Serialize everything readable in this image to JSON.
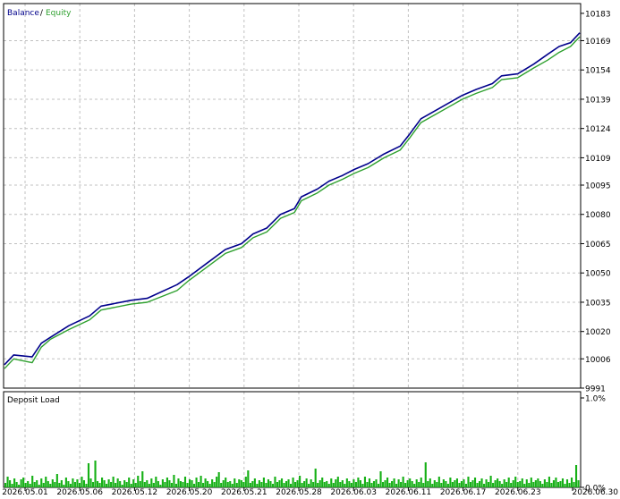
{
  "legend": {
    "balance_label": "Balance",
    "separator": " / ",
    "equity_label": "Equity"
  },
  "colors": {
    "balance": "#00008b",
    "equity": "#2ea02e",
    "deposit_load": "#16b016",
    "grid": "#c0c0c0",
    "frame": "#000000"
  },
  "chart_data": [
    {
      "type": "line",
      "title": "",
      "legend_placement": "top-left",
      "grid": true,
      "ylim": [
        9991,
        10188
      ],
      "y_ticks": [
        10183,
        10169,
        10154,
        10139,
        10124,
        10109,
        10095,
        10080,
        10065,
        10050,
        10035,
        10020,
        10006,
        9991
      ],
      "x_ticks": [
        "2026.05.01",
        "2026.05.06",
        "2026.05.12",
        "2026.05.20",
        "2026.05.21",
        "2026.05.28",
        "2026.06.03",
        "2026.06.11",
        "2026.06.17",
        "2026.06.23",
        "2026.06.30"
      ],
      "series": [
        {
          "name": "Balance",
          "points": [
            [
              0,
              10003
            ],
            [
              4,
              10008
            ],
            [
              12,
              10007
            ],
            [
              16,
              10014
            ],
            [
              20,
              10017
            ],
            [
              28,
              10023
            ],
            [
              37,
              10028
            ],
            [
              42,
              10033
            ],
            [
              55,
              10036
            ],
            [
              62,
              10037
            ],
            [
              75,
              10044
            ],
            [
              80,
              10048
            ],
            [
              88,
              10055
            ],
            [
              96,
              10062
            ],
            [
              103,
              10065
            ],
            [
              108,
              10070
            ],
            [
              114,
              10073
            ],
            [
              120,
              10080
            ],
            [
              126,
              10083
            ],
            [
              129,
              10089
            ],
            [
              136,
              10093
            ],
            [
              141,
              10097
            ],
            [
              147,
              10100
            ],
            [
              152,
              10103
            ],
            [
              158,
              10106
            ],
            [
              165,
              10111
            ],
            [
              172,
              10115
            ],
            [
              176,
              10121
            ],
            [
              181,
              10129
            ],
            [
              187,
              10133
            ],
            [
              193,
              10137
            ],
            [
              199,
              10141
            ],
            [
              205,
              10144
            ],
            [
              212,
              10147
            ],
            [
              216,
              10151
            ],
            [
              223,
              10152
            ],
            [
              230,
              10157
            ],
            [
              236,
              10162
            ],
            [
              241,
              10166
            ],
            [
              246,
              10168
            ],
            [
              250,
              10173
            ]
          ]
        },
        {
          "name": "Equity",
          "points": [
            [
              0,
              10001
            ],
            [
              4,
              10006
            ],
            [
              12,
              10004
            ],
            [
              16,
              10012
            ],
            [
              20,
              10016
            ],
            [
              28,
              10021
            ],
            [
              37,
              10026
            ],
            [
              42,
              10031
            ],
            [
              55,
              10034
            ],
            [
              62,
              10035
            ],
            [
              75,
              10041
            ],
            [
              80,
              10046
            ],
            [
              88,
              10053
            ],
            [
              96,
              10060
            ],
            [
              103,
              10063
            ],
            [
              108,
              10068
            ],
            [
              114,
              10071
            ],
            [
              120,
              10078
            ],
            [
              126,
              10081
            ],
            [
              129,
              10087
            ],
            [
              136,
              10091
            ],
            [
              141,
              10095
            ],
            [
              147,
              10098
            ],
            [
              152,
              10101
            ],
            [
              158,
              10104
            ],
            [
              165,
              10109
            ],
            [
              172,
              10113
            ],
            [
              176,
              10119
            ],
            [
              181,
              10127
            ],
            [
              187,
              10131
            ],
            [
              193,
              10135
            ],
            [
              199,
              10139
            ],
            [
              205,
              10142
            ],
            [
              212,
              10145
            ],
            [
              216,
              10149
            ],
            [
              223,
              10150
            ],
            [
              230,
              10155
            ],
            [
              236,
              10159
            ],
            [
              241,
              10163
            ],
            [
              246,
              10166
            ],
            [
              250,
              10171
            ]
          ]
        }
      ]
    },
    {
      "type": "bar",
      "title": "Deposit Load",
      "ylim": [
        0,
        1.0
      ],
      "y_ticks": [
        "1.0%",
        "0.0%"
      ],
      "values": [
        0.05,
        0.12,
        0.08,
        0.04,
        0.1,
        0.06,
        0.03,
        0.09,
        0.11,
        0.05,
        0.07,
        0.04,
        0.13,
        0.06,
        0.08,
        0.03,
        0.1,
        0.05,
        0.12,
        0.07,
        0.04,
        0.09,
        0.06,
        0.15,
        0.05,
        0.08,
        0.03,
        0.11,
        0.07,
        0.04,
        0.1,
        0.06,
        0.09,
        0.05,
        0.12,
        0.08,
        0.04,
        0.27,
        0.1,
        0.06,
        0.3,
        0.07,
        0.05,
        0.11,
        0.08,
        0.04,
        0.09,
        0.06,
        0.12,
        0.05,
        0.1,
        0.07,
        0.03,
        0.08,
        0.06,
        0.11,
        0.04,
        0.09,
        0.05,
        0.13,
        0.07,
        0.18,
        0.06,
        0.08,
        0.04,
        0.1,
        0.05,
        0.12,
        0.07,
        0.03,
        0.09,
        0.06,
        0.11,
        0.08,
        0.05,
        0.14,
        0.04,
        0.1,
        0.07,
        0.06,
        0.12,
        0.05,
        0.09,
        0.08,
        0.04,
        0.11,
        0.06,
        0.13,
        0.05,
        0.1,
        0.07,
        0.04,
        0.09,
        0.06,
        0.12,
        0.17,
        0.05,
        0.08,
        0.11,
        0.06,
        0.07,
        0.04,
        0.1,
        0.05,
        0.09,
        0.08,
        0.06,
        0.12,
        0.19,
        0.05,
        0.07,
        0.1,
        0.04,
        0.08,
        0.06,
        0.11,
        0.05,
        0.09,
        0.07,
        0.04,
        0.12,
        0.06,
        0.08,
        0.1,
        0.05,
        0.07,
        0.09,
        0.04,
        0.11,
        0.06,
        0.08,
        0.13,
        0.05,
        0.07,
        0.1,
        0.04,
        0.09,
        0.06,
        0.21,
        0.05,
        0.08,
        0.11,
        0.06,
        0.07,
        0.04,
        0.1,
        0.05,
        0.09,
        0.12,
        0.06,
        0.08,
        0.04,
        0.1,
        0.07,
        0.05,
        0.09,
        0.06,
        0.11,
        0.08,
        0.04,
        0.12,
        0.06,
        0.1,
        0.05,
        0.07,
        0.09,
        0.04,
        0.18,
        0.06,
        0.08,
        0.11,
        0.05,
        0.07,
        0.1,
        0.04,
        0.09,
        0.06,
        0.12,
        0.05,
        0.08,
        0.1,
        0.07,
        0.04,
        0.09,
        0.06,
        0.11,
        0.05,
        0.28,
        0.07,
        0.1,
        0.04,
        0.08,
        0.06,
        0.12,
        0.05,
        0.09,
        0.07,
        0.04,
        0.11,
        0.06,
        0.08,
        0.1,
        0.05,
        0.07,
        0.09,
        0.04,
        0.12,
        0.06,
        0.08,
        0.11,
        0.05,
        0.07,
        0.1,
        0.04,
        0.09,
        0.06,
        0.13,
        0.05,
        0.08,
        0.1,
        0.07,
        0.04,
        0.09,
        0.06,
        0.11,
        0.05,
        0.08,
        0.12,
        0.06,
        0.07,
        0.1,
        0.04,
        0.09,
        0.05,
        0.11,
        0.06,
        0.08,
        0.1,
        0.07,
        0.04,
        0.09,
        0.06,
        0.12,
        0.05,
        0.08,
        0.11,
        0.06,
        0.07,
        0.1,
        0.04,
        0.09,
        0.05,
        0.11,
        0.06,
        0.25,
        0.08
      ]
    }
  ]
}
